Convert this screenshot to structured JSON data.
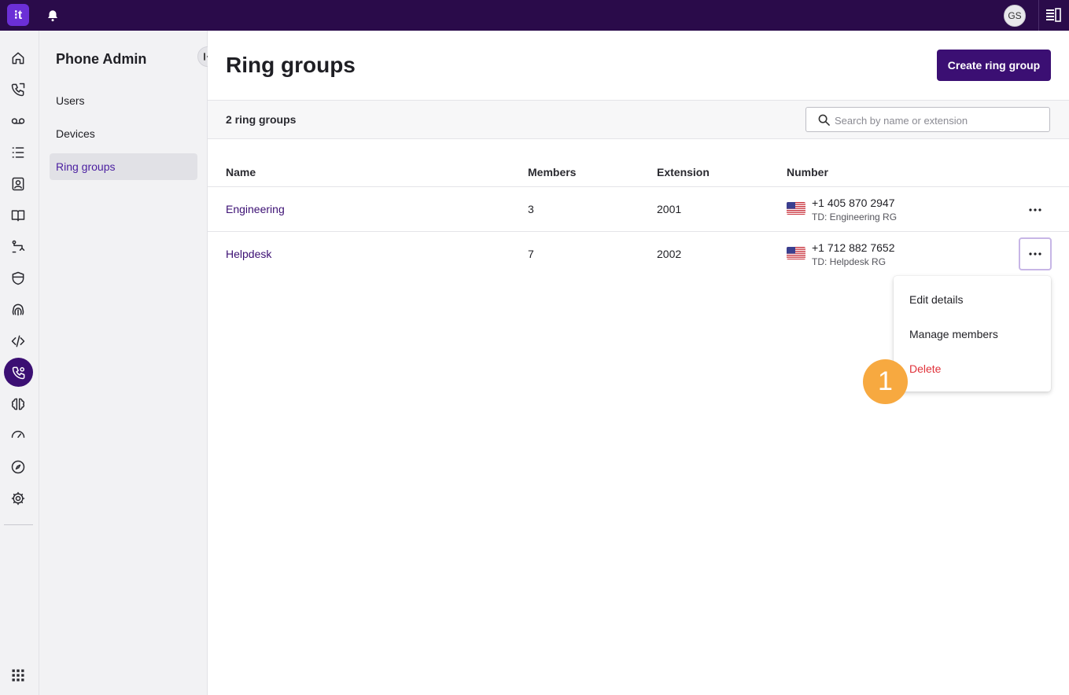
{
  "topbar": {
    "logo": "⁝t",
    "avatar_initials": "GS"
  },
  "sidebar": {
    "title": "Phone Admin",
    "items": [
      {
        "label": "Users",
        "selected": false
      },
      {
        "label": "Devices",
        "selected": false
      },
      {
        "label": "Ring groups",
        "selected": true
      }
    ]
  },
  "page": {
    "title": "Ring groups",
    "create_button": "Create ring group",
    "count_label": "2 ring groups",
    "search_placeholder": "Search by name or extension"
  },
  "table": {
    "columns": [
      "Name",
      "Members",
      "Extension",
      "Number"
    ],
    "rows": [
      {
        "name": "Engineering",
        "members": "3",
        "extension": "2001",
        "number": "+1 405 870 2947",
        "number_label": "TD: Engineering RG"
      },
      {
        "name": "Helpdesk",
        "members": "7",
        "extension": "2002",
        "number": "+1 712 882 7652",
        "number_label": "TD: Helpdesk RG"
      }
    ]
  },
  "menu": {
    "items": [
      {
        "label": "Edit details",
        "danger": false
      },
      {
        "label": "Manage members",
        "danger": false
      },
      {
        "label": "Delete",
        "danger": true
      }
    ]
  },
  "annotation": {
    "step": "1"
  },
  "colors": {
    "brand": "#3b0f73",
    "topbar": "#2a0b4a",
    "danger": "#e0323a",
    "badge": "#f7a940"
  }
}
